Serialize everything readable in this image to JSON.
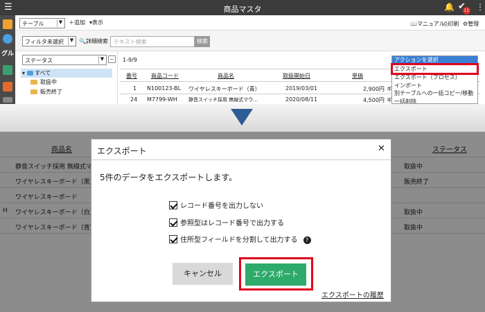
{
  "header": {
    "title": "商品マスタ",
    "badge_count": "11"
  },
  "sidebar": {
    "label": "グル"
  },
  "toolbar": {
    "view_select": "テーブル",
    "add_label": "追加",
    "display_label": "表示",
    "manual_label": "マニュアル",
    "print_label": "印刷",
    "admin_label": "管理"
  },
  "filter": {
    "filter_select": "フィルタ未選択",
    "detail_search_label": "詳細検索",
    "search_placeholder": "テキスト検索",
    "search_button": "検索"
  },
  "tree": {
    "dropdown": "ステータス",
    "root": "すべて",
    "items": [
      "取扱中",
      "販売終了"
    ]
  },
  "table": {
    "record_range": "1-9/9",
    "headers": [
      "番号",
      "商品コード",
      "商品名",
      "取扱開始日",
      "単価"
    ],
    "rows": [
      {
        "no": "1",
        "code": "N100123-BL",
        "name": "ワイヤレスキーボード（青）",
        "date": "2019/03/01",
        "price": "2,900円",
        "extra": "ギ"
      },
      {
        "no": "24",
        "code": "M7799-WH",
        "name": "静音スイッチ採用 無線式マウ…",
        "date": "2020/08/11",
        "price": "4,500円",
        "extra": "ギ"
      }
    ]
  },
  "action_menu": {
    "selected": "アクションを選択",
    "items": [
      "エクスポート",
      "エクスポート（プロセス）",
      "インポート",
      "別テーブルへの一括コピー/移動",
      "一括削除"
    ]
  },
  "background_table": {
    "headers": [
      "商品名",
      "ステータス"
    ],
    "rows": [
      {
        "prefix": "",
        "name": "静音スイッチ採用 無線式マ",
        "status": "取扱中"
      },
      {
        "prefix": "",
        "name": "ワイヤレスキーボード（黒）",
        "status": "販売終了"
      },
      {
        "prefix": "",
        "name": "ワイヤレスキーボード",
        "status": ""
      },
      {
        "prefix": "H",
        "name": "ワイヤレスキーボード（白）",
        "status": "取扱中"
      },
      {
        "prefix": "",
        "name": "ワイヤレスキーボード（青）",
        "status": "取扱中"
      }
    ]
  },
  "dialog": {
    "title": "エクスポート",
    "message": "5件のデータをエクスポートします。",
    "options": [
      {
        "label": "レコード番号を出力しない",
        "checked": true
      },
      {
        "label": "参照型はレコード番号で出力する",
        "checked": true
      },
      {
        "label": "住所型フィールドを分割して出力する",
        "checked": true
      }
    ],
    "cancel_label": "キャンセル",
    "export_label": "エクスポート",
    "history_link": "エクスポートの履歴"
  },
  "colors": {
    "topbar": "#3b3b3b",
    "export_button": "#2eaa6a",
    "highlight": "#e0001b",
    "arrow": "#2e5d95",
    "menu_selected": "#3b7fd4"
  }
}
